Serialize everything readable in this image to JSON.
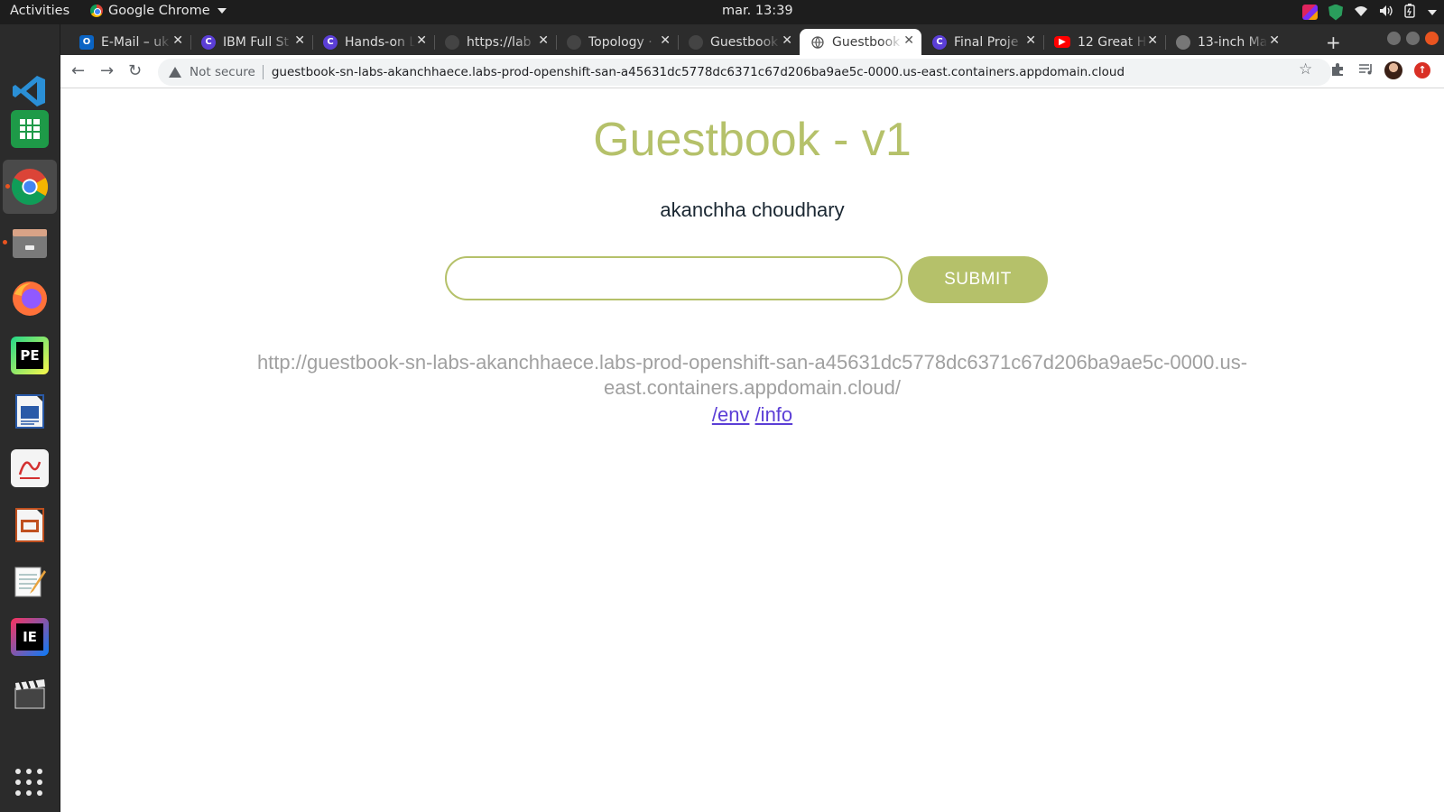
{
  "os": {
    "activities_label": "Activities",
    "app_name": "Google Chrome",
    "clock": "mar. 13:39"
  },
  "browser": {
    "tabs": [
      {
        "title": "E-Mail – uk",
        "icon": "outlook-icon",
        "active": false
      },
      {
        "title": "IBM Full St",
        "icon": "coursera-icon",
        "active": false
      },
      {
        "title": "Hands-on L",
        "icon": "coursera-icon",
        "active": false
      },
      {
        "title": "https://lab",
        "icon": "globe-icon",
        "active": false
      },
      {
        "title": "Topology ·",
        "icon": "globe-icon",
        "active": false
      },
      {
        "title": "Guestbook",
        "icon": "globe-icon",
        "active": false
      },
      {
        "title": "Guestbook",
        "icon": "globe-icon",
        "active": true
      },
      {
        "title": "Final Proje",
        "icon": "coursera-icon",
        "active": false
      },
      {
        "title": "12 Great H",
        "icon": "youtube-icon",
        "active": false
      },
      {
        "title": "13-inch Ma",
        "icon": "apple-icon",
        "active": false
      }
    ],
    "security_label": "Not secure",
    "url": "guestbook-sn-labs-akanchhaece.labs-prod-openshift-san-a45631dc5778dc6371c67d206ba9ae5c-0000.us-east.containers.appdomain.cloud"
  },
  "dock": {
    "apps": [
      "vscode-icon",
      "spreadsheet-icon",
      "chrome-icon",
      "files-icon",
      "firefox-icon",
      "pycharm-icon",
      "writer-icon",
      "pdf-viewer-icon",
      "impress-icon",
      "text-editor-icon",
      "intellij-icon",
      "video-editor-icon"
    ],
    "show_apps_icon": "app-grid-icon"
  },
  "guestbook": {
    "title": "Guestbook - v1",
    "entries": [
      "akanchha choudhary"
    ],
    "input_value": "",
    "submit_label": "SUBMIT",
    "host_url": "http://guestbook-sn-labs-akanchhaece.labs-prod-openshift-san-a45631dc5778dc6371c67d206ba9ae5c-0000.us-east.containers.appdomain.cloud/",
    "links": [
      "/env",
      "/info"
    ]
  },
  "colors": {
    "accent": "#b5c16a",
    "link": "#5b3ed6",
    "topbar": "#1d1d1d",
    "dock": "#2b2b2b",
    "tabstrip": "#2c2c2c"
  }
}
